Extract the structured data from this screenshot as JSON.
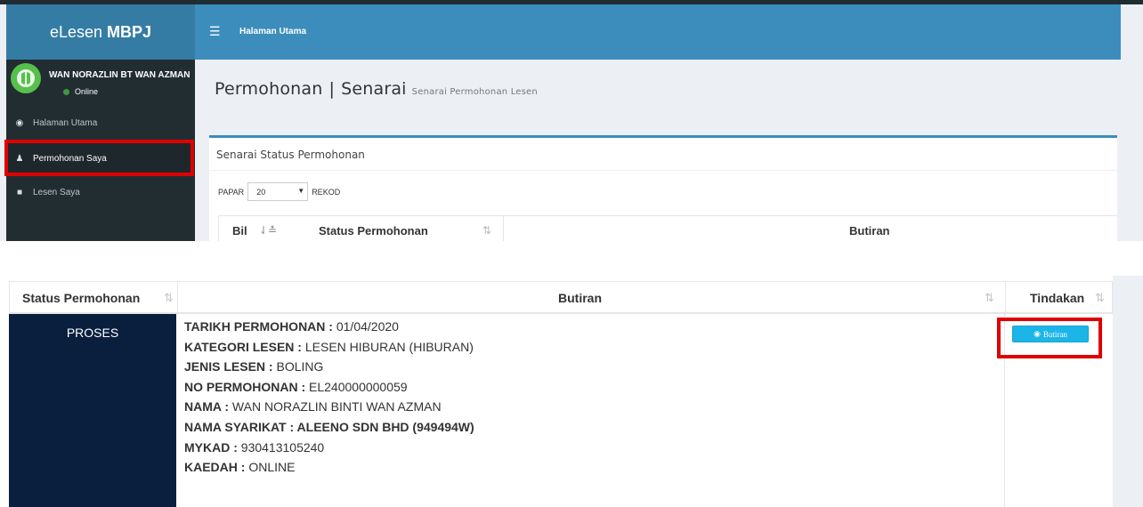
{
  "app": {
    "logo_plain": "eLesen",
    "logo_bold": "MBPJ"
  },
  "navbar": {
    "menu_icon": "hamburger-icon",
    "title": "Halaman Utama"
  },
  "user": {
    "name": "WAN NORAZLIN BT WAN AZMAN",
    "status": "Online"
  },
  "sidebar": {
    "items": [
      {
        "label": "Halaman Utama",
        "icon": "dashboard-icon"
      },
      {
        "label": "Permohonan Saya",
        "icon": "users-icon"
      },
      {
        "label": "Lesen Saya",
        "icon": "folder-icon"
      }
    ]
  },
  "page": {
    "title": "Permohonan",
    "separator": "|",
    "subtitle": "Senarai",
    "small": "Senarai Permohonan Lesen"
  },
  "box": {
    "title": "Senarai Status Permohonan",
    "show_label": "PAPAR",
    "page_size": "20",
    "records_label": "REKOD",
    "mini_headers": {
      "bil": "Bil",
      "status": "Status Permohonan",
      "butiran": "Butiran"
    }
  },
  "table": {
    "headers": {
      "status": "Status Permohonan",
      "butiran": "Butiran",
      "tindakan": "Tindakan"
    },
    "row": {
      "status": "PROSES",
      "details": [
        {
          "label": "TARIKH PERMOHONAN :",
          "value": " 01/04/2020"
        },
        {
          "label": "KATEGORI LESEN :",
          "value": " LESEN HIBURAN (HIBURAN)"
        },
        {
          "label": "JENIS LESEN :",
          "value": " BOLING"
        },
        {
          "label": "NO PERMOHONAN :",
          "value": " EL240000000059"
        },
        {
          "label": "NAMA :",
          "value": " WAN NORAZLIN BINTI WAN AZMAN"
        },
        {
          "label": "NAMA SYARIKAT :",
          "value": " ALEENO SDN BHD (949494W)"
        },
        {
          "label": "MYKAD :",
          "value": " 930413105240"
        },
        {
          "label": "KAEDAH :",
          "value": " ONLINE"
        }
      ],
      "action_label": "Butiran",
      "action_icon": "eye-icon"
    }
  },
  "colors": {
    "navbar": "#3c8dbc",
    "logo_bg": "#357ca5",
    "sidebar": "#222d32",
    "status_bg": "#0a1f3d",
    "button": "#1cb5e8",
    "highlight": "#e00000"
  }
}
